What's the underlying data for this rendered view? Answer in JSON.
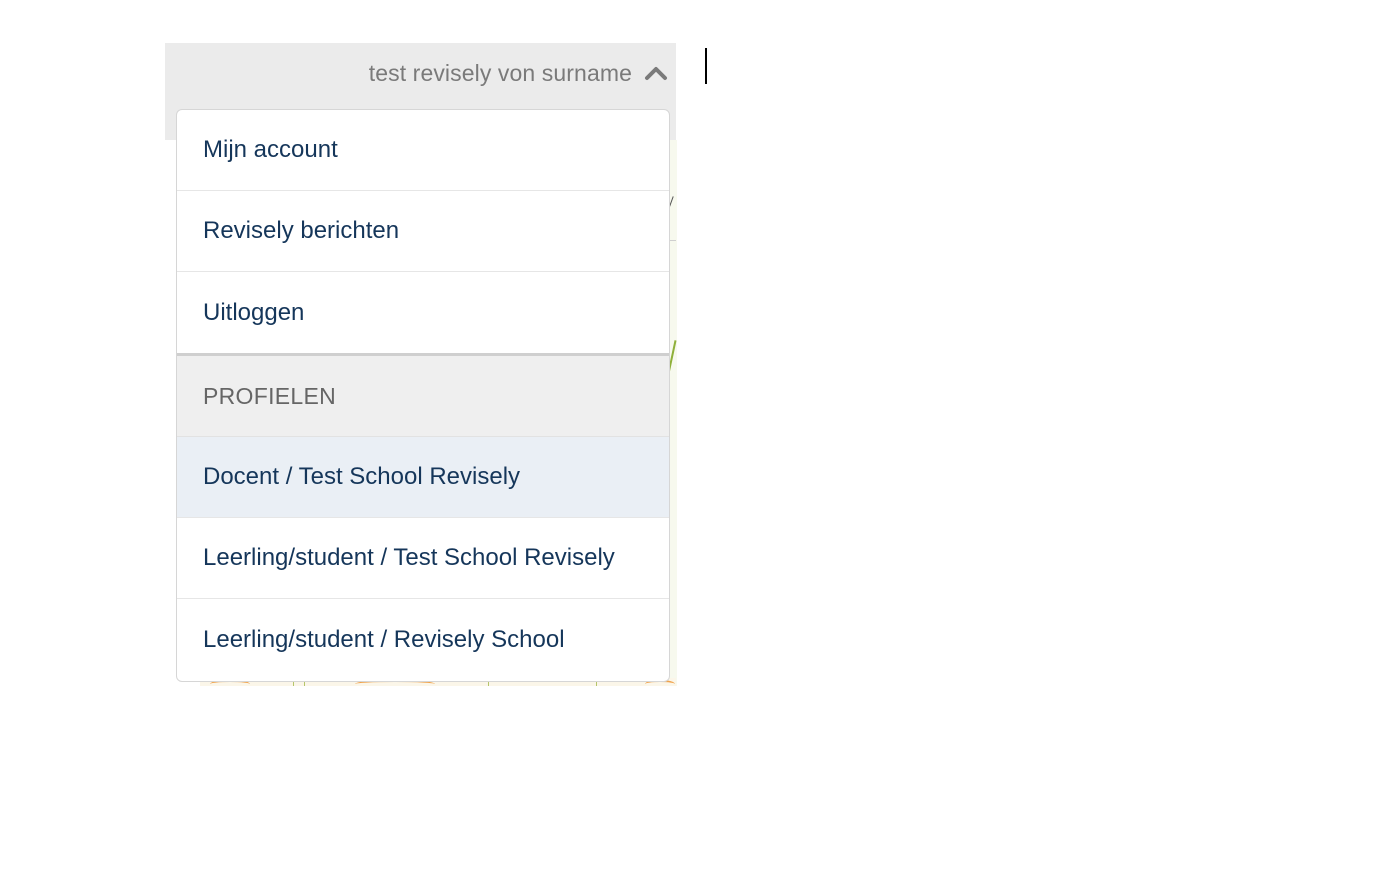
{
  "header": {
    "user_name": "test revisely von surname",
    "toggle_icon": "chevron-up-icon"
  },
  "account_menu": {
    "items": [
      {
        "label": "Mijn account"
      },
      {
        "label": "Revisely berichten"
      },
      {
        "label": "Uitloggen"
      }
    ]
  },
  "profiles": {
    "header": "PROFIELEN",
    "items": [
      {
        "label": "Docent / Test School Revisely",
        "active": true
      },
      {
        "label": "Leerling/student / Test School Revisely",
        "active": false
      },
      {
        "label": "Leerling/student / Revisely School",
        "active": false
      }
    ]
  },
  "colors": {
    "link_text": "#15365a",
    "muted_text": "#7a7a7a",
    "active_bg": "#eaeff5",
    "header_bg": "#efefef"
  }
}
